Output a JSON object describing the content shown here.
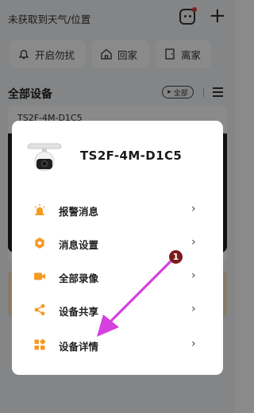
{
  "header": {
    "weather_text": "未获取到天气/位置"
  },
  "scenes": [
    {
      "label": "开启勿扰",
      "icon": "bell-icon"
    },
    {
      "label": "回家",
      "icon": "home-icon"
    },
    {
      "label": "离家",
      "icon": "door-icon"
    }
  ],
  "devices_section": {
    "title": "全部设备",
    "filter_label": "全部"
  },
  "background_card": {
    "device_name": "TS2F-4M-D1C5"
  },
  "popup": {
    "device_name": "TS2F-4M-D1C5",
    "items": [
      {
        "label": "报警消息",
        "icon": "alarm-light-icon",
        "color": "#f59a23"
      },
      {
        "label": "消息设置",
        "icon": "settings-gear-icon",
        "color": "#f59a23"
      },
      {
        "label": "全部录像",
        "icon": "video-camera-icon",
        "color": "#f59a23"
      },
      {
        "label": "设备共享",
        "icon": "share-icon",
        "color": "#f59a23"
      },
      {
        "label": "设备详情",
        "icon": "grid-squares-icon",
        "color": "#f59a23"
      }
    ],
    "chevron": "›"
  },
  "annotation": {
    "number": "1",
    "color": "#d63fe0"
  }
}
